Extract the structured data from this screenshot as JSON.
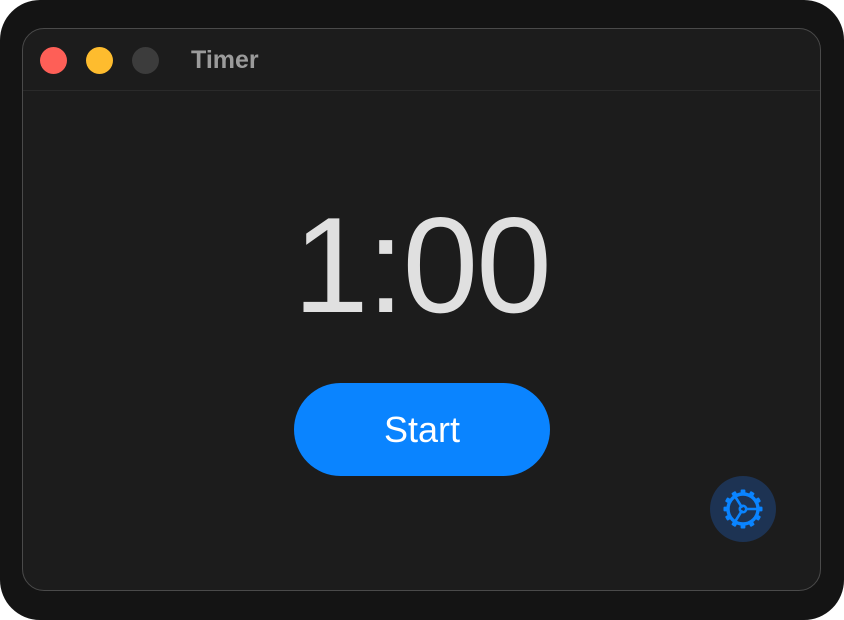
{
  "window": {
    "title": "Timer"
  },
  "timer": {
    "display": "1:00"
  },
  "controls": {
    "start_label": "Start",
    "settings_icon": "gear-icon"
  },
  "colors": {
    "close": "#fe5f57",
    "minimize": "#febc2e",
    "zoom_inactive": "#3c3c3c",
    "accent": "#0a84ff",
    "settings_bg": "#1d3353"
  }
}
